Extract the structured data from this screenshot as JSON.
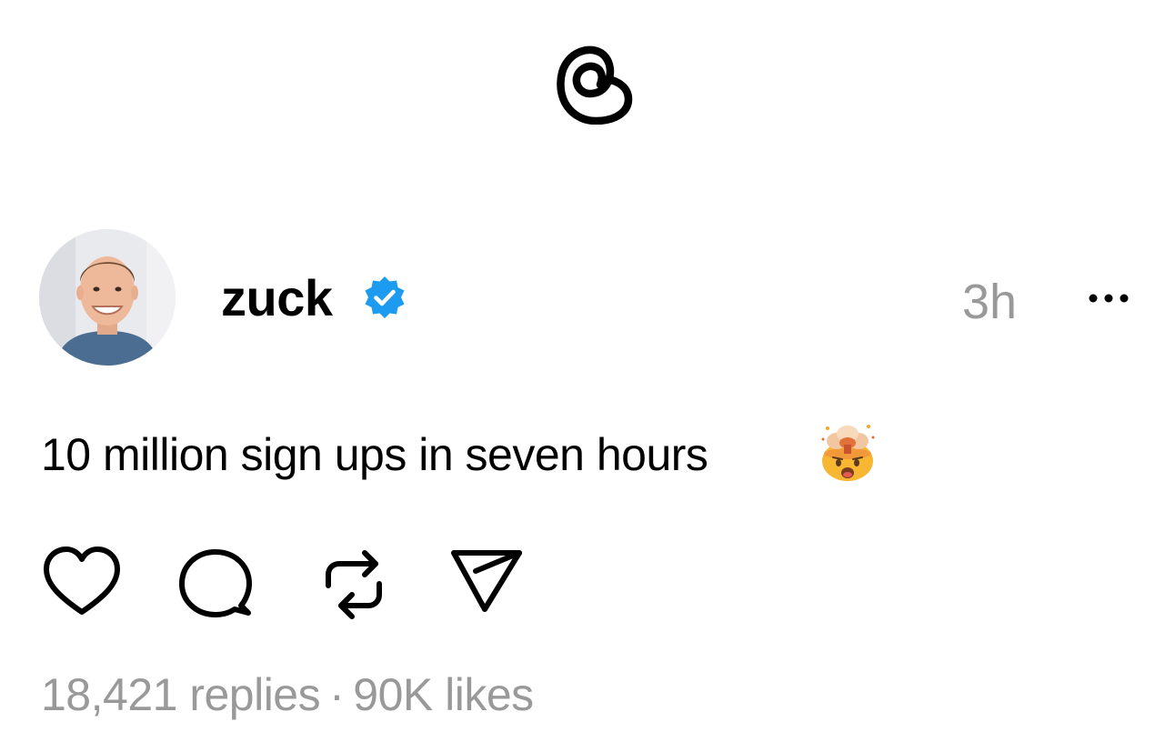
{
  "app": {
    "name": "Threads",
    "logo_icon": "threads-logo-icon"
  },
  "post": {
    "author": {
      "username": "zuck",
      "verified": true,
      "verified_icon": "verified-badge-icon",
      "verified_color": "#1d9bf0"
    },
    "timestamp": "3h",
    "more_icon": "more-horizontal-icon",
    "text": "10 million sign ups in seven hours",
    "emoji": "exploding-head-emoji",
    "actions": [
      {
        "name": "like",
        "icon": "heart-icon"
      },
      {
        "name": "reply",
        "icon": "comment-icon"
      },
      {
        "name": "repost",
        "icon": "repost-icon"
      },
      {
        "name": "share",
        "icon": "send-icon"
      }
    ],
    "stats": {
      "replies": "18,421 replies",
      "separator": "·",
      "likes": "90K likes"
    }
  },
  "colors": {
    "text": "#000000",
    "muted": "#999999",
    "background": "#ffffff"
  }
}
